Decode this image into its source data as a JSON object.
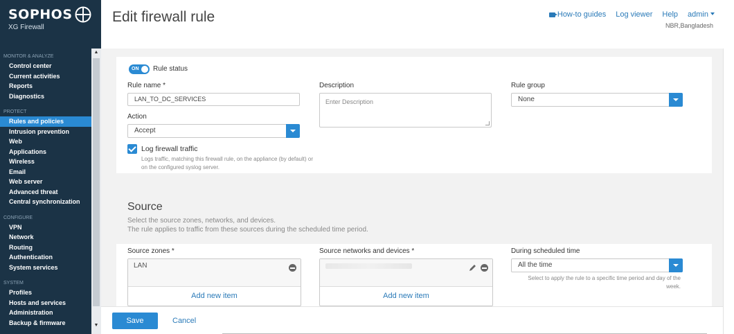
{
  "brand": {
    "name": "SOPHOS",
    "product": "XG Firewall"
  },
  "header": {
    "title": "Edit firewall rule",
    "links": {
      "how_to": "How-to guides",
      "log_viewer": "Log viewer",
      "help": "Help",
      "user": "admin"
    },
    "location": "NBR,Bangladesh"
  },
  "sidebar": {
    "sections": [
      {
        "title": "MONITOR & ANALYZE",
        "items": [
          "Control center",
          "Current activities",
          "Reports",
          "Diagnostics"
        ]
      },
      {
        "title": "PROTECT",
        "items": [
          "Rules and policies",
          "Intrusion prevention",
          "Web",
          "Applications",
          "Wireless",
          "Email",
          "Web server",
          "Advanced threat",
          "Central synchronization"
        ]
      },
      {
        "title": "CONFIGURE",
        "items": [
          "VPN",
          "Network",
          "Routing",
          "Authentication",
          "System services"
        ]
      },
      {
        "title": "SYSTEM",
        "items": [
          "Profiles",
          "Hosts and services",
          "Administration",
          "Backup & firmware"
        ]
      }
    ],
    "active_item": "Rules and policies"
  },
  "rule": {
    "status_toggle": "ON",
    "status_label": "Rule status",
    "name_label": "Rule name *",
    "name_value": "LAN_TO_DC_SERVICES",
    "description_label": "Description",
    "description_placeholder": "Enter Description",
    "group_label": "Rule group",
    "group_value": "None",
    "action_label": "Action",
    "action_value": "Accept",
    "log_label": "Log firewall traffic",
    "log_checked": true,
    "log_help": "Logs traffic, matching this firewall rule, on the appliance (by default) or on the configured syslog server."
  },
  "source": {
    "title": "Source",
    "desc1": "Select the source zones, networks, and devices.",
    "desc2": "The rule applies to traffic from these sources during the scheduled time period.",
    "zones_label": "Source zones *",
    "zones_value": "LAN",
    "networks_label": "Source networks and devices *",
    "schedule_label": "During scheduled time",
    "schedule_value": "All the time",
    "schedule_help": "Select to apply the rule to a specific time period and day of the week.",
    "add_new": "Add new item"
  },
  "footer": {
    "save": "Save",
    "cancel": "Cancel"
  },
  "colors": {
    "sidebar_bg": "#1b3346",
    "accent": "#2a8ad3",
    "link": "#2a7ab8"
  }
}
